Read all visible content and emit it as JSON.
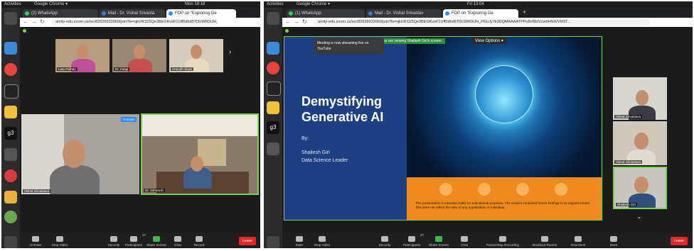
{
  "left": {
    "topbar": {
      "activities": "Activities",
      "app": "Google Chrome ▾",
      "clock": "Mon 18:18"
    },
    "tabs": [
      "(2) WhatsApp",
      "Mail - Dr. Vishal Srivasta",
      "FDP on \"Exploring Ge"
    ],
    "url": "amity-edu.zoom.us/wc/82636933969/join?fe=qkUR11l5Qe3BEGKvoF1Uff0dhd5Tl3cWRDiJH_PGuJy7k3DGNMAAAATPNPwNdIOVAA",
    "participants": [
      "Lata Pathan",
      "Dr. Iningi",
      "Anirudh Sood"
    ],
    "speaker_name": "Vishal Srivastava",
    "spotlight_badge": "Unmute",
    "pinned_name": "Dr. Ashutosh",
    "controls": [
      "Unmute",
      "Stop Video",
      "Security",
      "Participants",
      "Share Screen",
      "Chat",
      "Record"
    ],
    "participants_count": "27",
    "leave": "Leave"
  },
  "right": {
    "topbar": {
      "activities": "Activities",
      "app": "Google Chrome ▾",
      "clock": "Fri 13:04"
    },
    "tabs": [
      "(1) WhatsApp",
      "Mail - Dr. Vishal Srivastav",
      "FDP on \"Exploring Ge"
    ],
    "url": "amity-edu.zoom.us/wc/82636933969/join?fe=qkUR11l5Qe3BEGKvoF1Uff0dhd5Tl3cWRDiJH_PGuJy7k3DQMAAAATPPu8nNbIVcwdHNWVM3T...",
    "share_banner": "You are viewing Shailesh Giri's screen.",
    "view_options": "View Options ▾",
    "stream_notice": "Meeting is now streaming live on YouTube",
    "slide": {
      "title_line1": "Demystifying",
      "title_line2": "Generative AI",
      "by": "By:",
      "presenter": "Shailesh Giri",
      "role": "Data Science Leader",
      "disclaimer": "This presentation is intended solely for educational purposes. The content contained herein belongs to its original creator. This does not reflect the view of any organization or individual."
    },
    "gallery": [
      "Vishal Srivastava",
      "Vishal Srivastava",
      "Shailesh Giri"
    ],
    "controls": [
      "Mute",
      "Stop Video",
      "Security",
      "Participants",
      "Share Screen",
      "Chat",
      "Pause/Stop Recording",
      "Breakout Rooms",
      "Reactions",
      "More"
    ],
    "participants_count": "27",
    "leave": "Leave"
  },
  "colors": {
    "zoom_green": "#7ad14a",
    "leave_red": "#e02828",
    "slide_blue": "#1f3f83",
    "slide_orange": "#ef8a1e"
  }
}
